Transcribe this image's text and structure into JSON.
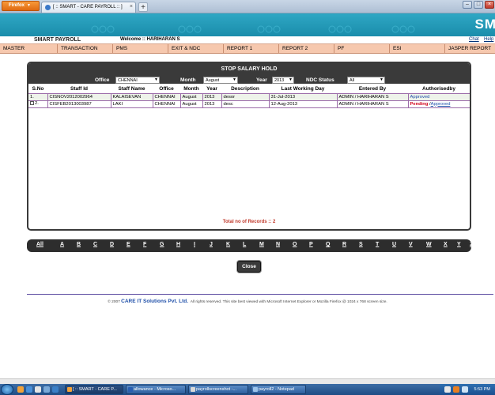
{
  "browser": {
    "menu_button": "Firefox",
    "tab_title": "[ :: SMART - CARE PAYROLL :: ]",
    "new_tab": "+"
  },
  "header": {
    "brand": "SM",
    "app_name": "SMART PAYROLL",
    "welcome": "Welcome :: HARIHARAN S",
    "chat_link": "Chat",
    "help_link": "Help"
  },
  "menu": [
    "MASTER",
    "TRANSACTION",
    "PMS",
    "EXIT & NDC",
    "REPORT 1",
    "REPORT 2",
    "PF",
    "ESI",
    "JASPER REPORT"
  ],
  "panel": {
    "title": "STOP SALARY HOLD",
    "filters": {
      "office_label": "Office",
      "office_value": "CHENNAI",
      "month_label": "Month",
      "month_value": "August",
      "year_label": "Year",
      "year_value": "2013",
      "ndc_label": "NDC Status",
      "ndc_value": "All"
    },
    "columns": [
      "S.No",
      "Staff Id",
      "Staff Name",
      "Office",
      "Month",
      "Year",
      "Description",
      "Last Working Day",
      "Entered By",
      "Authorisedby"
    ],
    "rows": [
      {
        "sno": "1.",
        "staff_id": "CISNOV2012002964",
        "staff_name": "KALAISEVAN",
        "office": "CHENNAI",
        "month": "August",
        "year": "2013",
        "description": "desor",
        "last_working_day": "31-Jul-2013",
        "entered_by": "ADMIN / HARIHARAN S",
        "status": "Approved"
      },
      {
        "sno": "2.",
        "staff_id": "CISFEB2013003987",
        "staff_name": "LAKI",
        "office": "CHENNAI",
        "month": "August",
        "year": "2013",
        "description": "desc",
        "last_working_day": "12-Aug-2013",
        "entered_by": "ADMIN / HARIHARAN S",
        "status": "Pending",
        "status_sep": " /",
        "status_link": "Approved"
      }
    ],
    "total_records": "Total no of Records :: 2"
  },
  "alphabet": [
    "All",
    "A",
    "B",
    "C",
    "D",
    "E",
    "F",
    "G",
    "H",
    "I",
    "J",
    "K",
    "L",
    "M",
    "N",
    "O",
    "P",
    "Q",
    "R",
    "S",
    "T",
    "U",
    "V",
    "W",
    "X",
    "Y",
    "Z"
  ],
  "close_button": "Close",
  "footer": {
    "copyright": "© 2007",
    "company": "CARE IT Solutions Pvt. Ltd.",
    "notice": "All rights reserved.   This site best viewed with Microsoft Internet Explorer or Mozilla Firefox @ 1024 x 768 screen size."
  },
  "taskbar": {
    "buttons": [
      "[ :: SMART - CARE P...",
      "allowance - Microso...",
      "payrollscreenshot -...",
      "payroll2 - Notepad"
    ],
    "clock": "5:53 PM"
  },
  "colors": {
    "banner": "#1a8dab",
    "menu_bar": "#f6c8ae",
    "panel_header": "#3a3a3a",
    "row_highlight": "#eef3ea",
    "pending": "#d0021b",
    "link": "#1d4ea8"
  }
}
